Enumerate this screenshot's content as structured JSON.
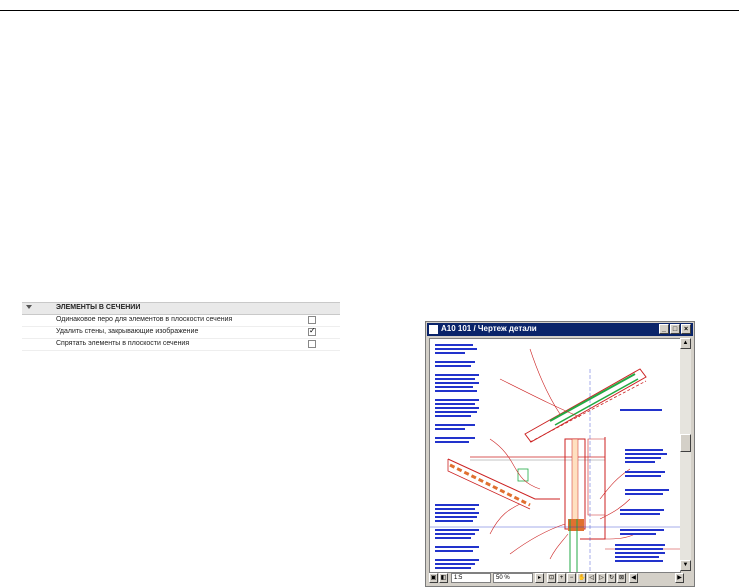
{
  "panel": {
    "header": "ЭЛЕМЕНТЫ В СЕЧЕНИИ",
    "rows": [
      {
        "label": "Одинаковое перо для элементов в плоскости сечения",
        "checked": false
      },
      {
        "label": "Удалить стены, закрывающие изображение",
        "checked": true
      },
      {
        "label": "Спрятать элементы в плоскости сечения",
        "checked": false
      }
    ]
  },
  "window": {
    "title": "A10 101 / Чертеж детали",
    "status": {
      "scale": "1:5",
      "zoom": "50 %"
    }
  }
}
